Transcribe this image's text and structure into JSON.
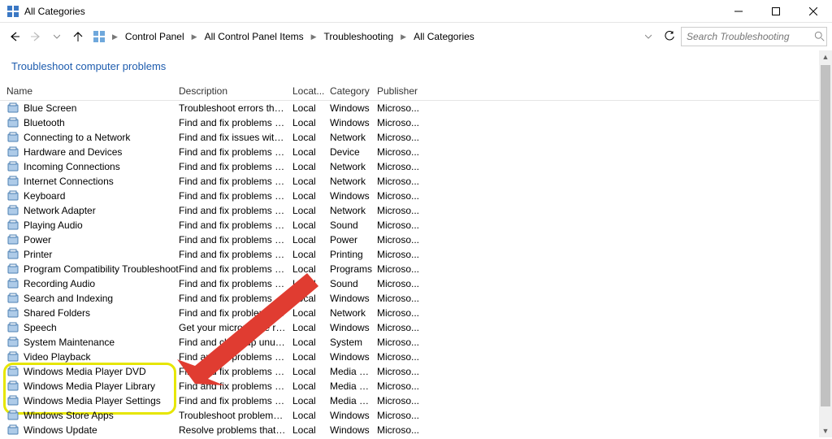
{
  "window": {
    "title": "All Categories"
  },
  "breadcrumbs": [
    "Control Panel",
    "All Control Panel Items",
    "Troubleshooting",
    "All Categories"
  ],
  "search": {
    "placeholder": "Search Troubleshooting"
  },
  "heading": "Troubleshoot computer problems",
  "columns": {
    "name": "Name",
    "description": "Description",
    "location": "Locat...",
    "category": "Category",
    "publisher": "Publisher"
  },
  "items": [
    {
      "name": "Blue Screen",
      "desc": "Troubleshoot errors that c...",
      "loc": "Local",
      "cat": "Windows",
      "pub": "Microso..."
    },
    {
      "name": "Bluetooth",
      "desc": "Find and fix problems with...",
      "loc": "Local",
      "cat": "Windows",
      "pub": "Microso..."
    },
    {
      "name": "Connecting to a Network",
      "desc": "Find and fix issues with co...",
      "loc": "Local",
      "cat": "Network",
      "pub": "Microso..."
    },
    {
      "name": "Hardware and Devices",
      "desc": "Find and fix problems with...",
      "loc": "Local",
      "cat": "Device",
      "pub": "Microso..."
    },
    {
      "name": "Incoming Connections",
      "desc": "Find and fix problems with...",
      "loc": "Local",
      "cat": "Network",
      "pub": "Microso..."
    },
    {
      "name": "Internet Connections",
      "desc": "Find and fix problems with...",
      "loc": "Local",
      "cat": "Network",
      "pub": "Microso..."
    },
    {
      "name": "Keyboard",
      "desc": "Find and fix problems with...",
      "loc": "Local",
      "cat": "Windows",
      "pub": "Microso..."
    },
    {
      "name": "Network Adapter",
      "desc": "Find and fix problems with...",
      "loc": "Local",
      "cat": "Network",
      "pub": "Microso..."
    },
    {
      "name": "Playing Audio",
      "desc": "Find and fix problems with...",
      "loc": "Local",
      "cat": "Sound",
      "pub": "Microso..."
    },
    {
      "name": "Power",
      "desc": "Find and fix problems with...",
      "loc": "Local",
      "cat": "Power",
      "pub": "Microso..."
    },
    {
      "name": "Printer",
      "desc": "Find and fix problems with...",
      "loc": "Local",
      "cat": "Printing",
      "pub": "Microso..."
    },
    {
      "name": "Program Compatibility Troubleshooter",
      "desc": "Find and fix problems with...",
      "loc": "Local",
      "cat": "Programs",
      "pub": "Microso..."
    },
    {
      "name": "Recording Audio",
      "desc": "Find and fix problems with...",
      "loc": "Local",
      "cat": "Sound",
      "pub": "Microso..."
    },
    {
      "name": "Search and Indexing",
      "desc": "Find and fix problems with...",
      "loc": "Local",
      "cat": "Windows",
      "pub": "Microso..."
    },
    {
      "name": "Shared Folders",
      "desc": "Find and fix problems with...",
      "loc": "Local",
      "cat": "Network",
      "pub": "Microso..."
    },
    {
      "name": "Speech",
      "desc": "Get your microphone read...",
      "loc": "Local",
      "cat": "Windows",
      "pub": "Microso..."
    },
    {
      "name": "System Maintenance",
      "desc": "Find and clean up unused f...",
      "loc": "Local",
      "cat": "System",
      "pub": "Microso..."
    },
    {
      "name": "Video Playback",
      "desc": "Find and fix problems play...",
      "loc": "Local",
      "cat": "Windows",
      "pub": "Microso..."
    },
    {
      "name": "Windows Media Player DVD",
      "desc": "Find and fix problems with...",
      "loc": "Local",
      "cat": "Media P...",
      "pub": "Microso..."
    },
    {
      "name": "Windows Media Player Library",
      "desc": "Find and fix problems with...",
      "loc": "Local",
      "cat": "Media P...",
      "pub": "Microso..."
    },
    {
      "name": "Windows Media Player Settings",
      "desc": "Find and fix problems with...",
      "loc": "Local",
      "cat": "Media P...",
      "pub": "Microso..."
    },
    {
      "name": "Windows Store Apps",
      "desc": "Troubleshoot problems th...",
      "loc": "Local",
      "cat": "Windows",
      "pub": "Microso..."
    },
    {
      "name": "Windows Update",
      "desc": "Resolve problems that pre...",
      "loc": "Local",
      "cat": "Windows",
      "pub": "Microso..."
    }
  ],
  "annotations": {
    "arrow_color": "#e03c31",
    "highlight_color": "#e6e600"
  }
}
